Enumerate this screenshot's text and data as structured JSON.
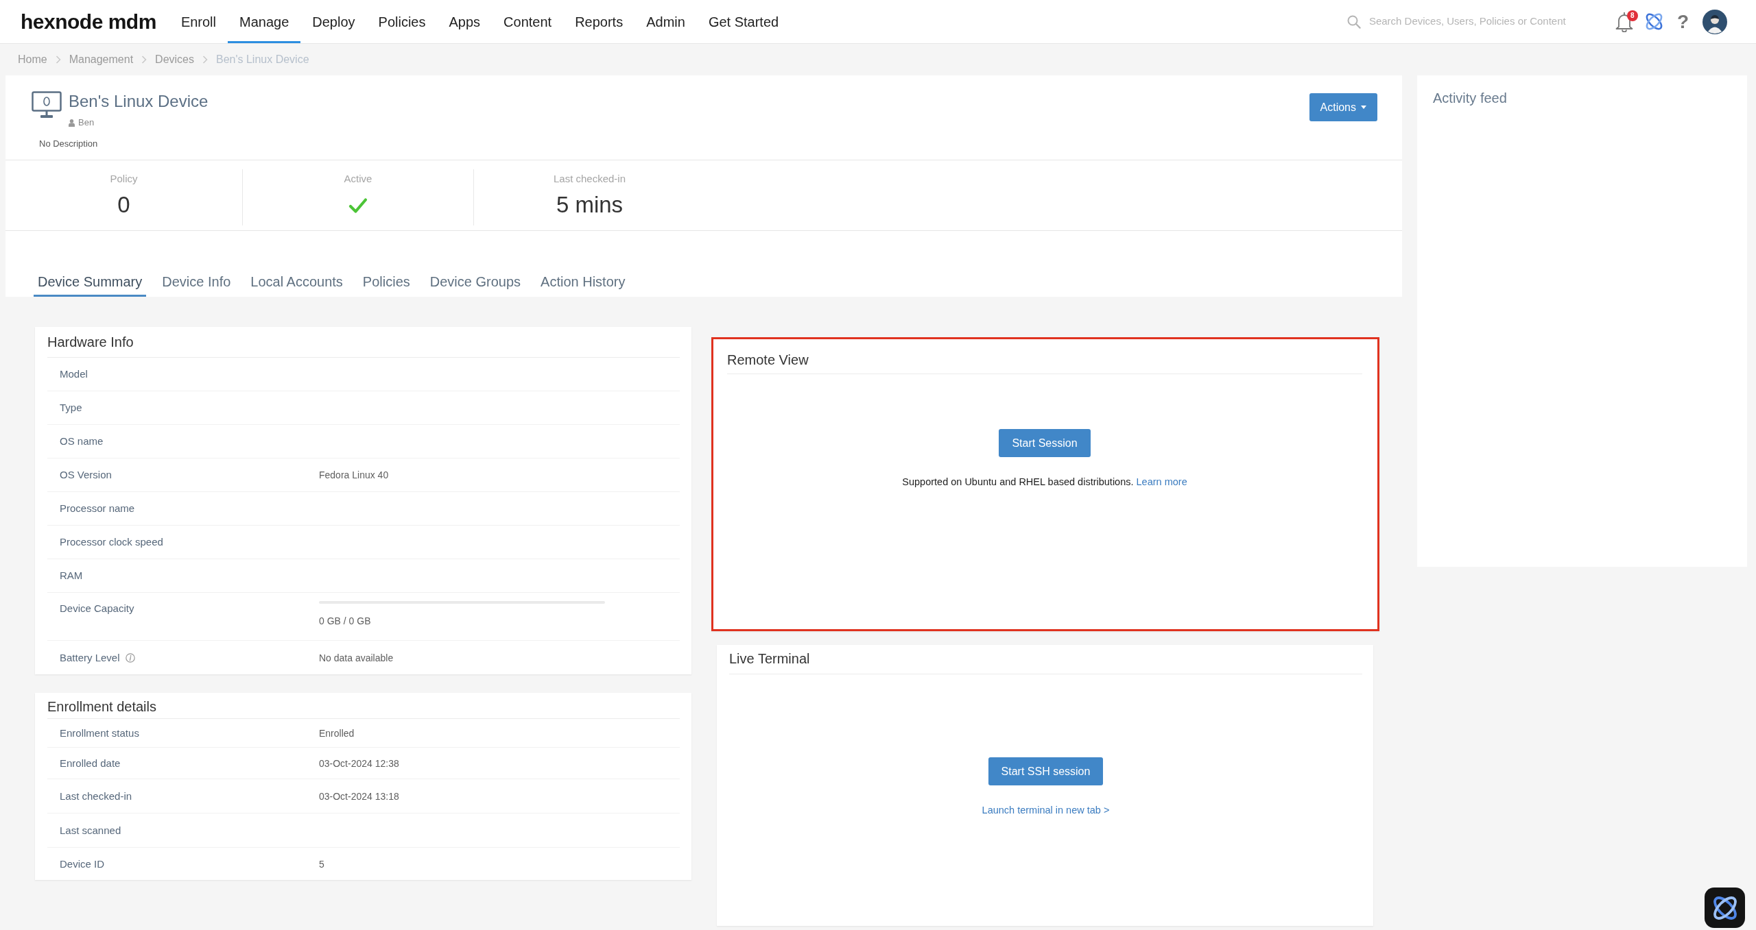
{
  "top_nav": {
    "logo": "hexnode mdm",
    "items": [
      {
        "label": "Enroll",
        "selected": false
      },
      {
        "label": "Manage",
        "selected": true
      },
      {
        "label": "Deploy",
        "selected": false
      },
      {
        "label": "Policies",
        "selected": false
      },
      {
        "label": "Apps",
        "selected": false
      },
      {
        "label": "Content",
        "selected": false
      },
      {
        "label": "Reports",
        "selected": false
      },
      {
        "label": "Admin",
        "selected": false
      },
      {
        "label": "Get Started",
        "selected": false
      }
    ],
    "search": {
      "placeholder": "Search Devices, Users, Policies or Content"
    },
    "notification_count": "8",
    "help": "?"
  },
  "breadcrumb": [
    {
      "label": "Home",
      "current": false
    },
    {
      "label": "Management",
      "current": false
    },
    {
      "label": "Devices",
      "current": false
    },
    {
      "label": "Ben's Linux Device",
      "current": true
    }
  ],
  "device": {
    "name": "Ben's Linux Device",
    "user": "Ben",
    "description": "No Description",
    "actions_button": "Actions"
  },
  "stats": [
    {
      "kind": "number",
      "label": "Policy",
      "value": "0"
    },
    {
      "kind": "status",
      "label": "Active",
      "active": true
    },
    {
      "kind": "number",
      "label": "Last checked-in",
      "value": "5 mins"
    }
  ],
  "tabs": [
    {
      "label": "Device Summary",
      "selected": true
    },
    {
      "label": "Device Info",
      "selected": false
    },
    {
      "label": "Local Accounts",
      "selected": false
    },
    {
      "label": "Policies",
      "selected": false
    },
    {
      "label": "Device Groups",
      "selected": false
    },
    {
      "label": "Action History",
      "selected": false
    }
  ],
  "hardware_info": {
    "title": "Hardware Info",
    "rows": [
      {
        "kind": "text",
        "label": "Model"
      },
      {
        "kind": "text",
        "label": "Type"
      },
      {
        "kind": "text",
        "label": "OS name"
      },
      {
        "kind": "text",
        "label": "OS Version",
        "value": "Fedora Linux 40"
      },
      {
        "kind": "text",
        "label": "Processor name"
      },
      {
        "kind": "text",
        "label": "Processor clock speed"
      },
      {
        "kind": "text",
        "label": "RAM"
      },
      {
        "kind": "meter",
        "label": "Device Capacity",
        "level": 0,
        "value": "0 GB / 0 GB"
      },
      {
        "kind": "info",
        "label": "Battery Level",
        "value": "No data available"
      }
    ]
  },
  "enrollment_details": {
    "title": "Enrollment details",
    "rows": [
      {
        "label": "Enrollment status",
        "value": "Enrolled"
      },
      {
        "label": "Enrolled date",
        "value": "03-Oct-2024 12:38"
      },
      {
        "label": "Last checked-in",
        "value": "03-Oct-2024 13:18"
      },
      {
        "label": "Last scanned"
      },
      {
        "label": "Device ID",
        "value": "5"
      }
    ]
  },
  "remote_view": {
    "title": "Remote View",
    "highlighted": true,
    "button": "Start Session",
    "note": "Supported on Ubuntu and RHEL based distributions.",
    "link": "Learn more"
  },
  "live_terminal": {
    "title": "Live Terminal",
    "button": "Start SSH session",
    "link": "Launch terminal in new tab >"
  },
  "activity_feed": {
    "title": "Activity feed"
  }
}
